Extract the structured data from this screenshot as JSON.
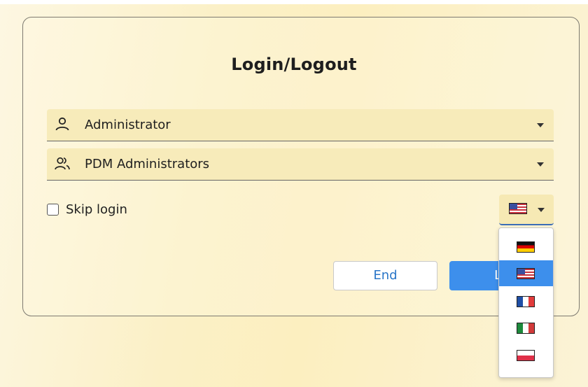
{
  "dialog": {
    "title": "Login/Logout",
    "user": {
      "value": "Administrator",
      "icon": "user-icon"
    },
    "group": {
      "value": "PDM Administrators",
      "icon": "users-group-icon"
    },
    "skip_login": {
      "label": "Skip login",
      "checked": false
    },
    "language": {
      "selected": "us-flag",
      "options": [
        "de-flag",
        "us-flag",
        "fr-flag",
        "it-flag",
        "pl-flag"
      ],
      "highlighted": "us-flag"
    },
    "buttons": {
      "end": "End",
      "login_visible": "Lo"
    }
  },
  "colors": {
    "accent": "#3d8fec",
    "field_bg": "#f7ebba",
    "background": "#fcefc0"
  }
}
